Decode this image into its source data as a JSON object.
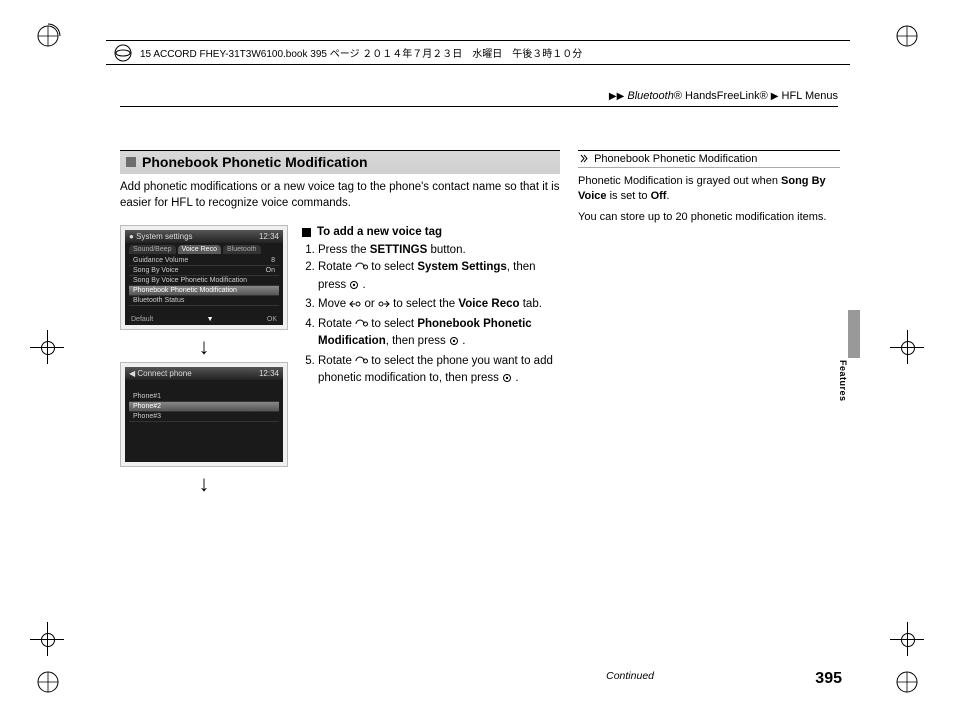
{
  "header_meta": "15 ACCORD FHEY-31T3W6100.book  395 ページ  ２０１４年７月２３日　水曜日　午後３時１０分",
  "breadcrumb": {
    "seg1_italic": "Bluetooth",
    "seg1_reg": "®",
    "seg2": " HandsFreeLink®",
    "seg3": "HFL Menus"
  },
  "section": {
    "title": "Phonebook Phonetic Modification",
    "intro": "Add phonetic modifications or a new voice tag to the phone's contact name so that it is easier for HFL to recognize voice commands."
  },
  "steps": {
    "lead": "To add a new voice tag",
    "s1a": "Press the ",
    "s1b": "SETTINGS",
    "s1c": " button.",
    "s2a": "Rotate ",
    "s2b": " to select ",
    "s2c": "System Settings",
    "s2d": ", then press ",
    "s2e": ".",
    "s3a": "Move ",
    "s3b": " or ",
    "s3c": " to select the ",
    "s3d": "Voice Reco",
    "s3e": " tab.",
    "s4a": "Rotate ",
    "s4b": " to select ",
    "s4c": "Phonebook Phonetic Modification",
    "s4d": ", then press ",
    "s4e": ".",
    "s5a": "Rotate ",
    "s5b": " to select the phone you want to add phonetic modification to, then press ",
    "s5e": "."
  },
  "screens": {
    "a": {
      "title": "System settings",
      "clock": "12:34",
      "tabs": [
        "Sound/Beep",
        "Voice Reco",
        "Bluetooth"
      ],
      "rows": [
        {
          "label": "Guidance Volume",
          "value": "8"
        },
        {
          "label": "Song By Voice",
          "value": "On"
        },
        {
          "label": "Song By Voice Phonetic Modification",
          "value": ""
        },
        {
          "label": "Phonebook Phonetic Modification",
          "value": ""
        },
        {
          "label": "Bluetooth Status",
          "value": ""
        }
      ],
      "btn_left": "Default",
      "btn_right": "OK"
    },
    "b": {
      "title": "Connect phone",
      "clock": "12:34",
      "rows": [
        {
          "label": "Phone#1"
        },
        {
          "label": "Phone#2"
        },
        {
          "label": "Phone#3"
        }
      ]
    }
  },
  "right": {
    "heading": "Phonebook Phonetic Modification",
    "p1a": "Phonetic Modification is grayed out when ",
    "p1b": "Song By Voice",
    "p1c": " is set to ",
    "p1d": "Off",
    "p1e": ".",
    "p2": "You can store up to 20 phonetic modification items."
  },
  "side_tab": "Features",
  "continued": "Continued",
  "page_number": "395"
}
